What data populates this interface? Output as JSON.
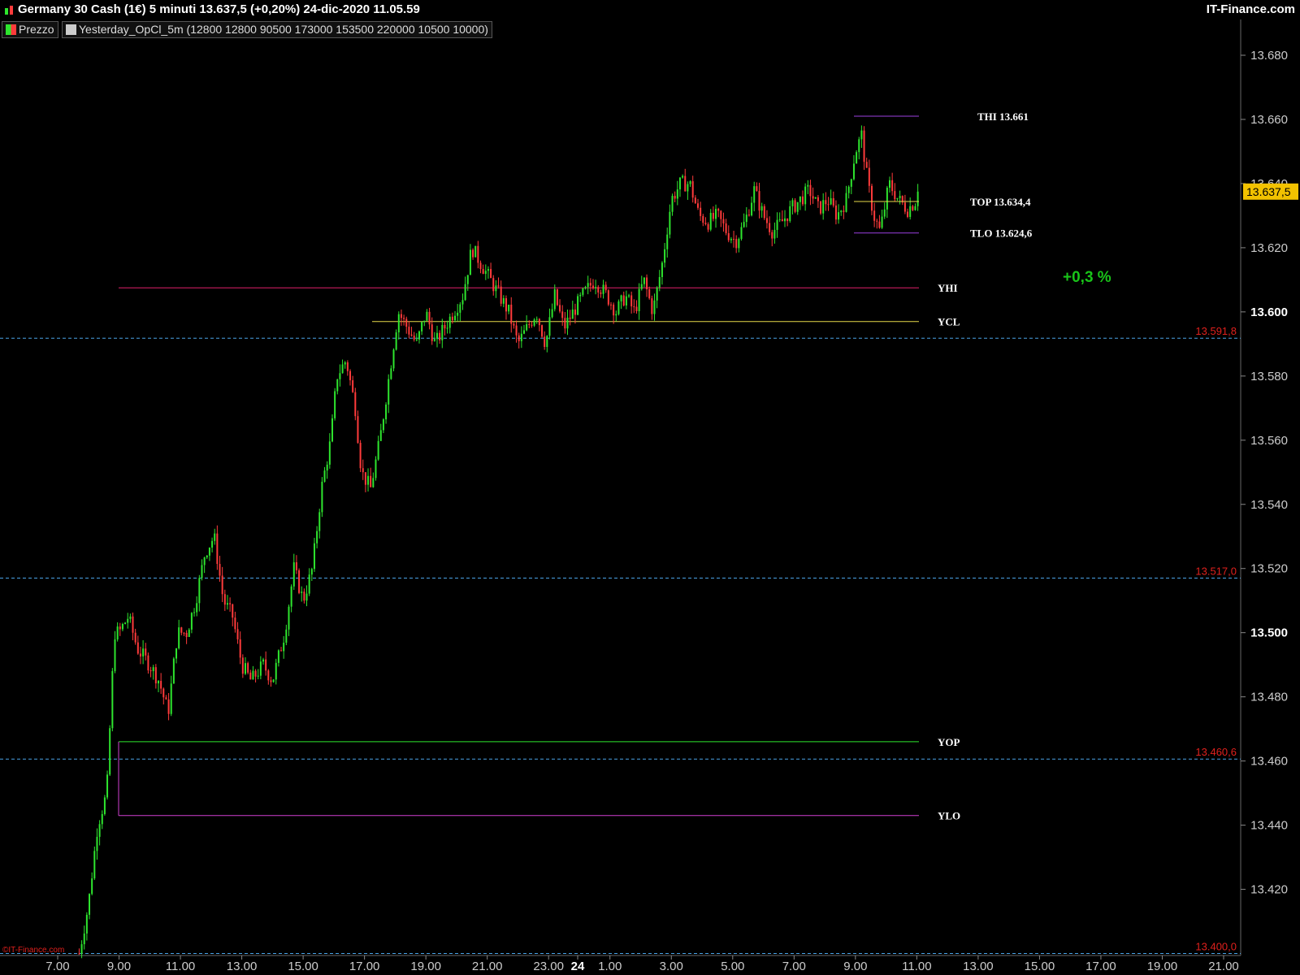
{
  "header": {
    "title": "Germany 30 Cash (1€) 5 minuti 13.637,5 (+0,20%) 24-dic-2020 11.05.59",
    "brand": "IT-Finance.com"
  },
  "legend": {
    "price_label": "Prezzo",
    "indicator_label": "Yesterday_OpCl_5m (12800 12800 90500 173000 153500 220000 10500 10000)"
  },
  "watermark": "©IT-Finance.com",
  "colors": {
    "up": "#2ee52e",
    "down": "#ff3b3b",
    "yhi": "#e0206a",
    "ycl": "#e6d94a",
    "yop": "#2ee52e",
    "ylo": "#d13fd1",
    "today_range": "#9b3fe0",
    "today_open": "#e6d94a",
    "dashed": "#4aa3e6",
    "price_box": "#f2c200"
  },
  "chart_data": {
    "type": "candlestick",
    "instrument": "Germany 30 Cash (1€)",
    "timeframe": "5 minuti",
    "ylim": [
      13400,
      13690
    ],
    "y_ticks": [
      "13.420",
      "13.440",
      "13.460",
      "13.480",
      "13.500",
      "13.520",
      "13.540",
      "13.560",
      "13.580",
      "13.600",
      "13.620",
      "13.640",
      "13.660",
      "13.680"
    ],
    "y_bold_ticks": [
      "13.500",
      "13.600"
    ],
    "x_ticks": [
      "7.00",
      "9.00",
      "11.00",
      "13.00",
      "15.00",
      "17.00",
      "19.00",
      "21.00",
      "23.00",
      "24",
      "1.00",
      "3.00",
      "5.00",
      "7.00",
      "9.00",
      "11.00",
      "13.00",
      "15.00",
      "17.00",
      "19.00",
      "21.00"
    ],
    "x_bold_ticks": [
      "24"
    ],
    "last_price": "13.637,5",
    "price_path": [
      [
        7.7,
        13400
      ],
      [
        8.0,
        13415
      ],
      [
        8.3,
        13440
      ],
      [
        8.6,
        13450
      ],
      [
        8.85,
        13500
      ],
      [
        9.0,
        13500
      ],
      [
        9.3,
        13505
      ],
      [
        9.6,
        13495
      ],
      [
        10.0,
        13490
      ],
      [
        10.3,
        13485
      ],
      [
        10.6,
        13475
      ],
      [
        10.9,
        13500
      ],
      [
        11.2,
        13500
      ],
      [
        11.5,
        13510
      ],
      [
        11.8,
        13525
      ],
      [
        12.1,
        13530
      ],
      [
        12.4,
        13510
      ],
      [
        12.7,
        13505
      ],
      [
        13.0,
        13490
      ],
      [
        13.3,
        13485
      ],
      [
        13.7,
        13490
      ],
      [
        14.0,
        13485
      ],
      [
        14.4,
        13500
      ],
      [
        14.7,
        13520
      ],
      [
        15.0,
        13510
      ],
      [
        15.3,
        13520
      ],
      [
        15.6,
        13545
      ],
      [
        15.9,
        13560
      ],
      [
        16.1,
        13580
      ],
      [
        16.4,
        13585
      ],
      [
        16.7,
        13570
      ],
      [
        16.9,
        13550
      ],
      [
        17.2,
        13545
      ],
      [
        17.5,
        13560
      ],
      [
        17.8,
        13580
      ],
      [
        18.1,
        13600
      ],
      [
        18.4,
        13595
      ],
      [
        18.7,
        13590
      ],
      [
        19.0,
        13600
      ],
      [
        19.3,
        13590
      ],
      [
        19.6,
        13595
      ],
      [
        19.9,
        13600
      ],
      [
        20.2,
        13605
      ],
      [
        20.5,
        13620
      ],
      [
        20.8,
        13615
      ],
      [
        21.1,
        13610
      ],
      [
        21.4,
        13605
      ],
      [
        21.7,
        13600
      ],
      [
        22.0,
        13590
      ],
      [
        22.3,
        13595
      ],
      [
        22.6,
        13600
      ],
      [
        22.9,
        13590
      ],
      [
        23.2,
        13605
      ],
      [
        23.5,
        13595
      ],
      [
        23.8,
        13600
      ],
      [
        24.1,
        13605
      ],
      [
        24.5,
        13610
      ],
      [
        24.9,
        13605
      ],
      [
        25.2,
        13600
      ],
      [
        25.5,
        13605
      ],
      [
        25.8,
        13600
      ],
      [
        26.1,
        13610
      ],
      [
        26.4,
        13600
      ],
      [
        26.7,
        13615
      ],
      [
        27.0,
        13635
      ],
      [
        27.3,
        13640
      ],
      [
        27.6,
        13640
      ],
      [
        27.9,
        13630
      ],
      [
        28.2,
        13628
      ],
      [
        28.5,
        13630
      ],
      [
        28.8,
        13625
      ],
      [
        29.1,
        13622
      ],
      [
        29.4,
        13628
      ],
      [
        29.7,
        13638
      ],
      [
        30.0,
        13630
      ],
      [
        30.3,
        13625
      ],
      [
        30.6,
        13628
      ],
      [
        30.9,
        13632
      ],
      [
        31.2,
        13635
      ],
      [
        31.5,
        13638
      ],
      [
        31.8,
        13632
      ],
      [
        32.1,
        13635
      ],
      [
        32.4,
        13630
      ],
      [
        32.7,
        13635
      ],
      [
        33.0,
        13650
      ],
      [
        33.2,
        13655
      ],
      [
        33.4,
        13640
      ],
      [
        33.6,
        13630
      ],
      [
        33.8,
        13625
      ],
      [
        34.1,
        13640
      ],
      [
        34.4,
        13635
      ],
      [
        34.7,
        13632
      ],
      [
        35.0,
        13635
      ],
      [
        35.1,
        13637.5
      ]
    ],
    "levels": [
      {
        "name": "YHI",
        "value": 13607.5
      },
      {
        "name": "YCL",
        "value": 13597
      },
      {
        "name": "YOP",
        "value": 13466
      },
      {
        "name": "YLO",
        "value": 13443
      }
    ],
    "today_levels": [
      {
        "label": "THI 13.661",
        "value": 13661
      },
      {
        "label": "TOP 13.634,4",
        "value": 13634.4
      },
      {
        "label": "TLO 13.624,6",
        "value": 13624.6
      }
    ],
    "horizontal_lines": [
      {
        "label": "13.591,8",
        "value": 13591.8
      },
      {
        "label": "13.517,0",
        "value": 13517.0
      },
      {
        "label": "13.460,6",
        "value": 13460.6
      },
      {
        "label": "13.400,0",
        "value": 13400.0
      }
    ],
    "change_annotation": "+0,3 %"
  }
}
